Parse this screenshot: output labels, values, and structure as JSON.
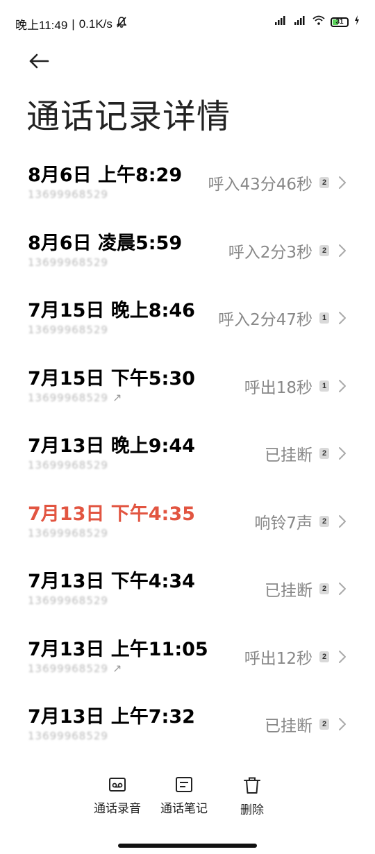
{
  "status_bar": {
    "time": "晚上11:49",
    "speed": "0.1K/s",
    "battery": "31",
    "colors": {
      "battery_fill": "#5ad25a"
    }
  },
  "header": {
    "title": "通话记录详情",
    "back_icon": "arrow-left-icon"
  },
  "colors": {
    "missed": "#e25541",
    "secondary": "#888888"
  },
  "calls": [
    {
      "time": "8月6日 上午8:29",
      "number": "13699968529",
      "status": "呼入43分46秒",
      "sim": "2",
      "outgoing": false,
      "missed": false
    },
    {
      "time": "8月6日 凌晨5:59",
      "number": "13699968529",
      "status": "呼入2分3秒",
      "sim": "2",
      "outgoing": false,
      "missed": false
    },
    {
      "time": "7月15日 晚上8:46",
      "number": "13699968529",
      "status": "呼入2分47秒",
      "sim": "1",
      "outgoing": false,
      "missed": false
    },
    {
      "time": "7月15日 下午5:30",
      "number": "13699968529",
      "status": "呼出18秒",
      "sim": "1",
      "outgoing": true,
      "missed": false
    },
    {
      "time": "7月13日 晚上9:44",
      "number": "13699968529",
      "status": "已挂断",
      "sim": "2",
      "outgoing": false,
      "missed": false
    },
    {
      "time": "7月13日 下午4:35",
      "number": "13699968529",
      "status": "响铃7声",
      "sim": "2",
      "outgoing": false,
      "missed": true
    },
    {
      "time": "7月13日 下午4:34",
      "number": "13699968529",
      "status": "已挂断",
      "sim": "2",
      "outgoing": false,
      "missed": false
    },
    {
      "time": "7月13日 上午11:05",
      "number": "13699968529",
      "status": "呼出12秒",
      "sim": "2",
      "outgoing": true,
      "missed": false
    },
    {
      "time": "7月13日 上午7:32",
      "number": "13699968529",
      "status": "已挂断",
      "sim": "2",
      "outgoing": false,
      "missed": false
    }
  ],
  "bottom_actions": [
    {
      "label": "通话录音",
      "icon": "recording-icon"
    },
    {
      "label": "通话笔记",
      "icon": "note-icon"
    },
    {
      "label": "删除",
      "icon": "trash-icon"
    }
  ]
}
